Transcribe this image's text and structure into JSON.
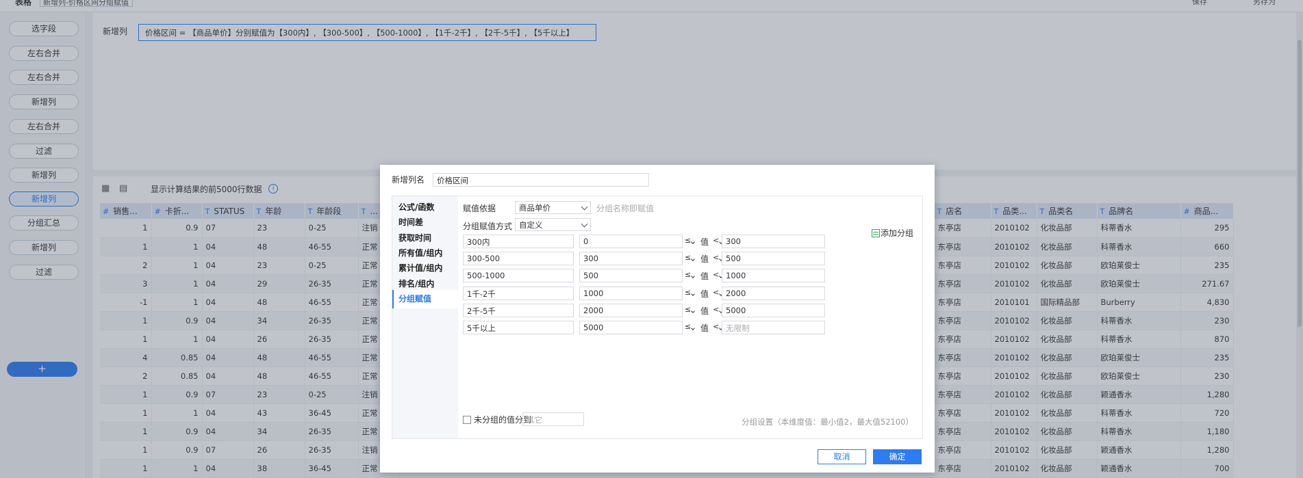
{
  "topbar": {
    "title": "表格",
    "input_value": "新增列-价格区间分组赋值",
    "right_action_1": "保存",
    "right_action_2": "另存为"
  },
  "steps": [
    {
      "label": "选字段",
      "active": false
    },
    {
      "label": "左右合并",
      "active": false
    },
    {
      "label": "左右合并",
      "active": false
    },
    {
      "label": "新增列",
      "active": false
    },
    {
      "label": "左右合并",
      "active": false
    },
    {
      "label": "过滤",
      "active": false
    },
    {
      "label": "新增列",
      "active": false
    },
    {
      "label": "新增列",
      "active": true
    },
    {
      "label": "分组汇总",
      "active": false
    },
    {
      "label": "新增列",
      "active": false
    },
    {
      "label": "过滤",
      "active": false
    }
  ],
  "add_step_label": "+",
  "formula_area": {
    "label": "新增列",
    "formula": "价格区间 = 【商品单价】分别赋值为【300内】, 【300-500】, 【500-1000】, 【1千-2千】, 【2千-5千】, 【5千以上】"
  },
  "table_toolbar": {
    "info": "显示计算结果的前5000行数据",
    "info_icon": "i"
  },
  "table": {
    "headers": [
      {
        "type": "#",
        "name": "销售..."
      },
      {
        "type": "#",
        "name": "卡折..."
      },
      {
        "type": "T",
        "name": "STATUS"
      },
      {
        "type": "T",
        "name": "年龄"
      },
      {
        "type": "T",
        "name": "年龄段"
      },
      {
        "type": "T",
        "name": "..."
      },
      {
        "type": "",
        "name": ""
      },
      {
        "type": "T",
        "name": "店名"
      },
      {
        "type": "T",
        "name": "品类..."
      },
      {
        "type": "T",
        "name": "品类名"
      },
      {
        "type": "T",
        "name": "品牌名"
      },
      {
        "type": "#",
        "name": "商品..."
      }
    ],
    "rows": [
      [
        "1",
        "0.9",
        "07",
        "23",
        "0-25",
        "注销",
        "",
        "东亭店",
        "2010102",
        "化妆品部",
        "科蒂香水",
        "295"
      ],
      [
        "1",
        "1",
        "04",
        "48",
        "46-55",
        "正常",
        "",
        "东亭店",
        "2010102",
        "化妆品部",
        "科蒂香水",
        "660"
      ],
      [
        "2",
        "1",
        "04",
        "23",
        "0-25",
        "正常",
        "",
        "东亭店",
        "2010102",
        "化妆品部",
        "欧珀莱俊士",
        "235"
      ],
      [
        "3",
        "1",
        "04",
        "29",
        "26-35",
        "正常",
        "",
        "东亭店",
        "2010102",
        "化妆品部",
        "欧珀莱俊士",
        "271.67"
      ],
      [
        "-1",
        "1",
        "04",
        "48",
        "46-55",
        "正常",
        "",
        "东亭店",
        "2010101",
        "国际精品部",
        "Burberry",
        "4,830"
      ],
      [
        "1",
        "0.9",
        "04",
        "34",
        "26-35",
        "正常",
        "",
        "东亭店",
        "2010102",
        "化妆品部",
        "科蒂香水",
        "230"
      ],
      [
        "1",
        "1",
        "04",
        "26",
        "26-35",
        "正常",
        "",
        "东亭店",
        "2010102",
        "化妆品部",
        "科蒂香水",
        "870"
      ],
      [
        "4",
        "0.85",
        "04",
        "48",
        "46-55",
        "正常",
        "",
        "东亭店",
        "2010102",
        "化妆品部",
        "欧珀莱俊士",
        "235"
      ],
      [
        "2",
        "0.85",
        "04",
        "48",
        "46-55",
        "正常",
        "",
        "东亭店",
        "2010102",
        "化妆品部",
        "欧珀莱俊士",
        "230"
      ],
      [
        "1",
        "0.9",
        "07",
        "23",
        "0-25",
        "注销",
        "",
        "东亭店",
        "2010102",
        "化妆品部",
        "颖通香水",
        "1,280"
      ],
      [
        "1",
        "1",
        "04",
        "43",
        "36-45",
        "正常",
        "",
        "东亭店",
        "2010102",
        "化妆品部",
        "科蒂香水",
        "720"
      ],
      [
        "1",
        "0.9",
        "04",
        "34",
        "26-35",
        "正常",
        "",
        "东亭店",
        "2010102",
        "化妆品部",
        "科蒂香水",
        "1,180"
      ],
      [
        "1",
        "0.9",
        "07",
        "26",
        "26-35",
        "注销",
        "",
        "东亭店",
        "2010102",
        "化妆品部",
        "颖通香水",
        "1,280"
      ],
      [
        "1",
        "1",
        "04",
        "38",
        "36-45",
        "正常",
        "",
        "东亭店",
        "2010102",
        "化妆品部",
        "颖通香水",
        "700"
      ]
    ]
  },
  "modal": {
    "name_label": "新增列名",
    "name_value": "价格区间",
    "menu": [
      {
        "label": "公式/函数",
        "active": false
      },
      {
        "label": "时间差",
        "active": false
      },
      {
        "label": "获取时间",
        "active": false
      },
      {
        "label": "所有值/组内",
        "active": false
      },
      {
        "label": "累计值/组内",
        "active": false
      },
      {
        "label": "排名/组内",
        "active": false
      },
      {
        "label": "分组赋值",
        "active": true
      }
    ],
    "basis_label": "赋值依据",
    "basis_value": "商品单价",
    "basis_hint": "分组名称即赋值",
    "method_label": "分组赋值方式",
    "method_value": "自定义",
    "add_group": "添加分组",
    "value_label": "值",
    "groups": [
      {
        "name": "300内",
        "min": "0",
        "op1": "≤",
        "op2": "<",
        "max": "300",
        "max_placeholder": false
      },
      {
        "name": "300-500",
        "min": "300",
        "op1": "≤",
        "op2": "<",
        "max": "500",
        "max_placeholder": false
      },
      {
        "name": "500-1000",
        "min": "500",
        "op1": "≤",
        "op2": "<",
        "max": "1000",
        "max_placeholder": false
      },
      {
        "name": "1千-2千",
        "min": "1000",
        "op1": "≤",
        "op2": "<",
        "max": "2000",
        "max_placeholder": false
      },
      {
        "name": "2千-5千",
        "min": "2000",
        "op1": "≤",
        "op2": "<",
        "max": "5000",
        "max_placeholder": false
      },
      {
        "name": "5千以上",
        "min": "5000",
        "op1": "≤",
        "op2": "<",
        "max": "无限制",
        "max_placeholder": true
      }
    ],
    "ungrouped_label": "未分组的值分到",
    "ungrouped_placeholder": "其它",
    "group_note": "分组设置（本维度值：最小值2，最大值52100）",
    "cancel": "取消",
    "ok": "确定"
  }
}
